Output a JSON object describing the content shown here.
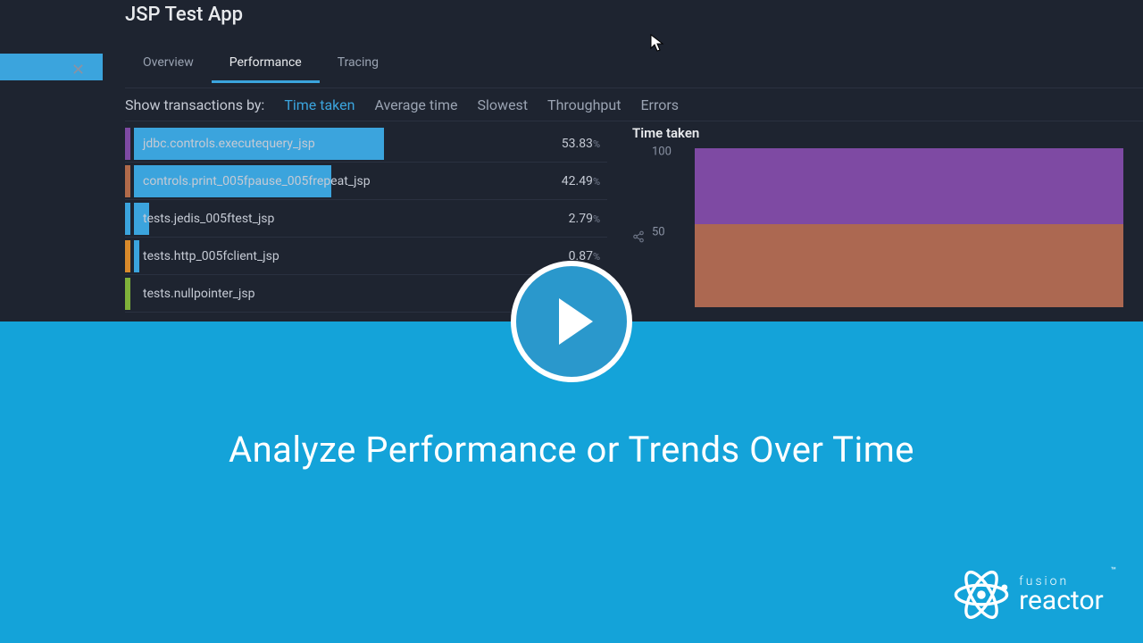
{
  "app": {
    "title": "JSP Test App"
  },
  "tabs": [
    {
      "label": "Overview",
      "active": false
    },
    {
      "label": "Performance",
      "active": true
    },
    {
      "label": "Tracing",
      "active": false
    }
  ],
  "filter": {
    "label": "Show transactions by:",
    "options": [
      {
        "label": "Time taken",
        "active": true
      },
      {
        "label": "Average time",
        "active": false
      },
      {
        "label": "Slowest",
        "active": false
      },
      {
        "label": "Throughput",
        "active": false
      },
      {
        "label": "Errors",
        "active": false
      }
    ]
  },
  "transactions": [
    {
      "name": "jdbc.controls.executequery_jsp",
      "pct": "53.83",
      "color": "#7e4aa3",
      "bar_width_pct": 100
    },
    {
      "name": "controls.print_005fpause_005frepeat_jsp",
      "pct": "42.49",
      "color": "#b06a4a",
      "bar_width_pct": 79
    },
    {
      "name": "tests.jedis_005ftest_jsp",
      "pct": "2.79",
      "color": "#3ba4dd",
      "bar_width_pct": 6
    },
    {
      "name": "tests.http_005fclient_jsp",
      "pct": "0.87",
      "color": "#d98a2b",
      "bar_width_pct": 2
    },
    {
      "name": "tests.nullpointer_jsp",
      "pct": "",
      "color": "#7fb23a",
      "bar_width_pct": 0
    }
  ],
  "chart": {
    "title": "Time taken",
    "yticks": {
      "top": "100",
      "mid": "50"
    }
  },
  "chart_data": {
    "type": "area",
    "title": "Time taken",
    "ylabel": "%",
    "ylim": [
      0,
      100
    ],
    "series": [
      {
        "name": "jdbc.controls.executequery_jsp",
        "color": "#7e4aa3",
        "approx_share_pct": 53.83
      },
      {
        "name": "controls.print_005fpause_005frepeat_jsp",
        "color": "#b06a4a",
        "approx_share_pct": 42.49
      }
    ],
    "stacked": true,
    "note": "visible region shows stacked area roughly split 54/42 between purple and brown layers"
  },
  "promo": {
    "title": "Analyze Performance or Trends Over Time",
    "brand_top": "fusion",
    "brand_bottom": "reactor",
    "tm": "™"
  },
  "pct_symbol": "%"
}
